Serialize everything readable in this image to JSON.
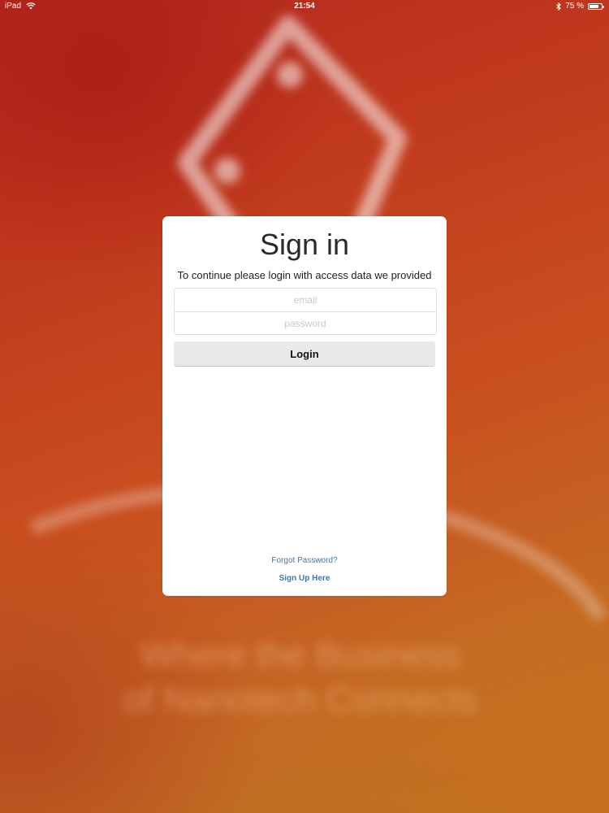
{
  "status_bar": {
    "device": "iPad",
    "time": "21:54",
    "battery_text": "75 %",
    "battery_level": 0.75,
    "icons": [
      "wifi-icon",
      "bluetooth-icon",
      "battery-icon"
    ]
  },
  "background": {
    "tagline_line1": "Where the Business",
    "tagline_line2": "of Nanotech Connects"
  },
  "signin": {
    "title": "Sign in",
    "subtitle": "To continue please login with access data we provided",
    "email_placeholder": "email",
    "email_value": "",
    "password_placeholder": "password",
    "password_value": "",
    "login_label": "Login",
    "forgot_label": "Forgot Password?",
    "signup_label": "Sign Up Here"
  },
  "colors": {
    "link": "#3b78b5",
    "button_bg": "#e9e9eb",
    "background_primary": "#c2451d"
  }
}
